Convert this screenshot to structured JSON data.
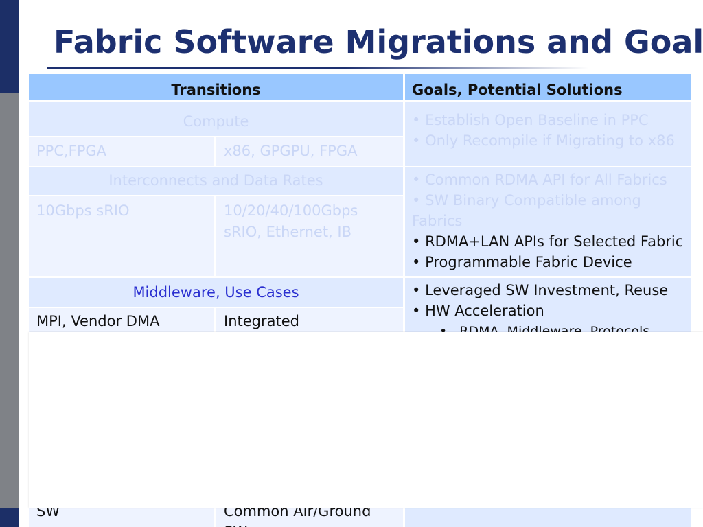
{
  "title": "Fabric Software Migrations and Goals",
  "table": {
    "headers": {
      "transitions": "Transitions",
      "goals": "Goals, Potential Solutions"
    },
    "sections": [
      {
        "name": "Compute",
        "rows": [
          {
            "from": "PPC,FPGA",
            "to": "x86, GPGPU, FPGA"
          }
        ],
        "goals": [
          "Establish Open Baseline in PPC",
          "Only Recompile if Migrating to x86"
        ]
      },
      {
        "name": "Interconnects and Data Rates",
        "rows": [
          {
            "from": "10Gbps sRIO",
            "to": "10/20/40/100Gbps sRIO, Ethernet, IB"
          }
        ],
        "goals": [
          "Common RDMA API for All Fabrics",
          "SW Binary Compatible among Fabrics",
          "RDMA+LAN APIs for Selected Fabric",
          "Programmable Fabric Device"
        ]
      },
      {
        "name": "Middleware, Use Cases",
        "rows": [
          {
            "from": "MPI, Vendor DMA",
            "to": "Integrated"
          }
        ],
        "goals": [
          "Leveraged SW Investment, Reuse",
          "HW Acceleration"
        ],
        "sub_goals": [
          "RDMA, Middleware, Protocols"
        ]
      },
      {
        "rows": [
          {
            "from": "SW",
            "to": "Common Air/Ground SW"
          }
        ]
      }
    ]
  }
}
